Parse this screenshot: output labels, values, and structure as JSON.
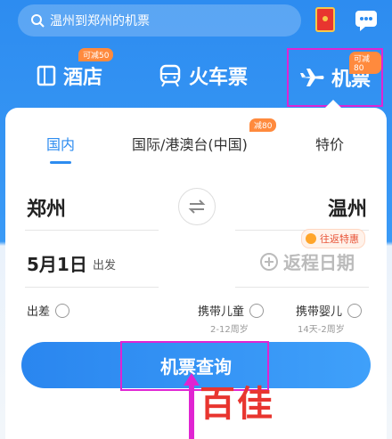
{
  "search": {
    "placeholder": "温州到郑州的机票"
  },
  "categories": [
    {
      "label": "酒店",
      "badge": "可减50"
    },
    {
      "label": "火车票",
      "badge": ""
    },
    {
      "label": "机票",
      "badge": "可减80"
    }
  ],
  "tabs": [
    {
      "label": "国内"
    },
    {
      "label": "国际/港澳台(中国)",
      "badge": "减80"
    },
    {
      "label": "特价"
    }
  ],
  "route": {
    "from": "郑州",
    "to": "温州"
  },
  "dates": {
    "depart": "5月1日",
    "depart_suffix": "出发",
    "return_placeholder": "返程日期",
    "round_trip_badge": "往返特惠"
  },
  "options": [
    {
      "label": "出差",
      "sub": ""
    },
    {
      "label": "携带儿童",
      "sub": "2-12周岁"
    },
    {
      "label": "携带婴儿",
      "sub": "14天-2周岁"
    }
  ],
  "search_button": {
    "label": "机票查询"
  },
  "watermark": {
    "text": "百佳"
  },
  "colors": {
    "primary": "#2d8cf0",
    "highlight": "#e024d2",
    "badge": "#ff8a3d",
    "watermark": "#e8352f"
  }
}
